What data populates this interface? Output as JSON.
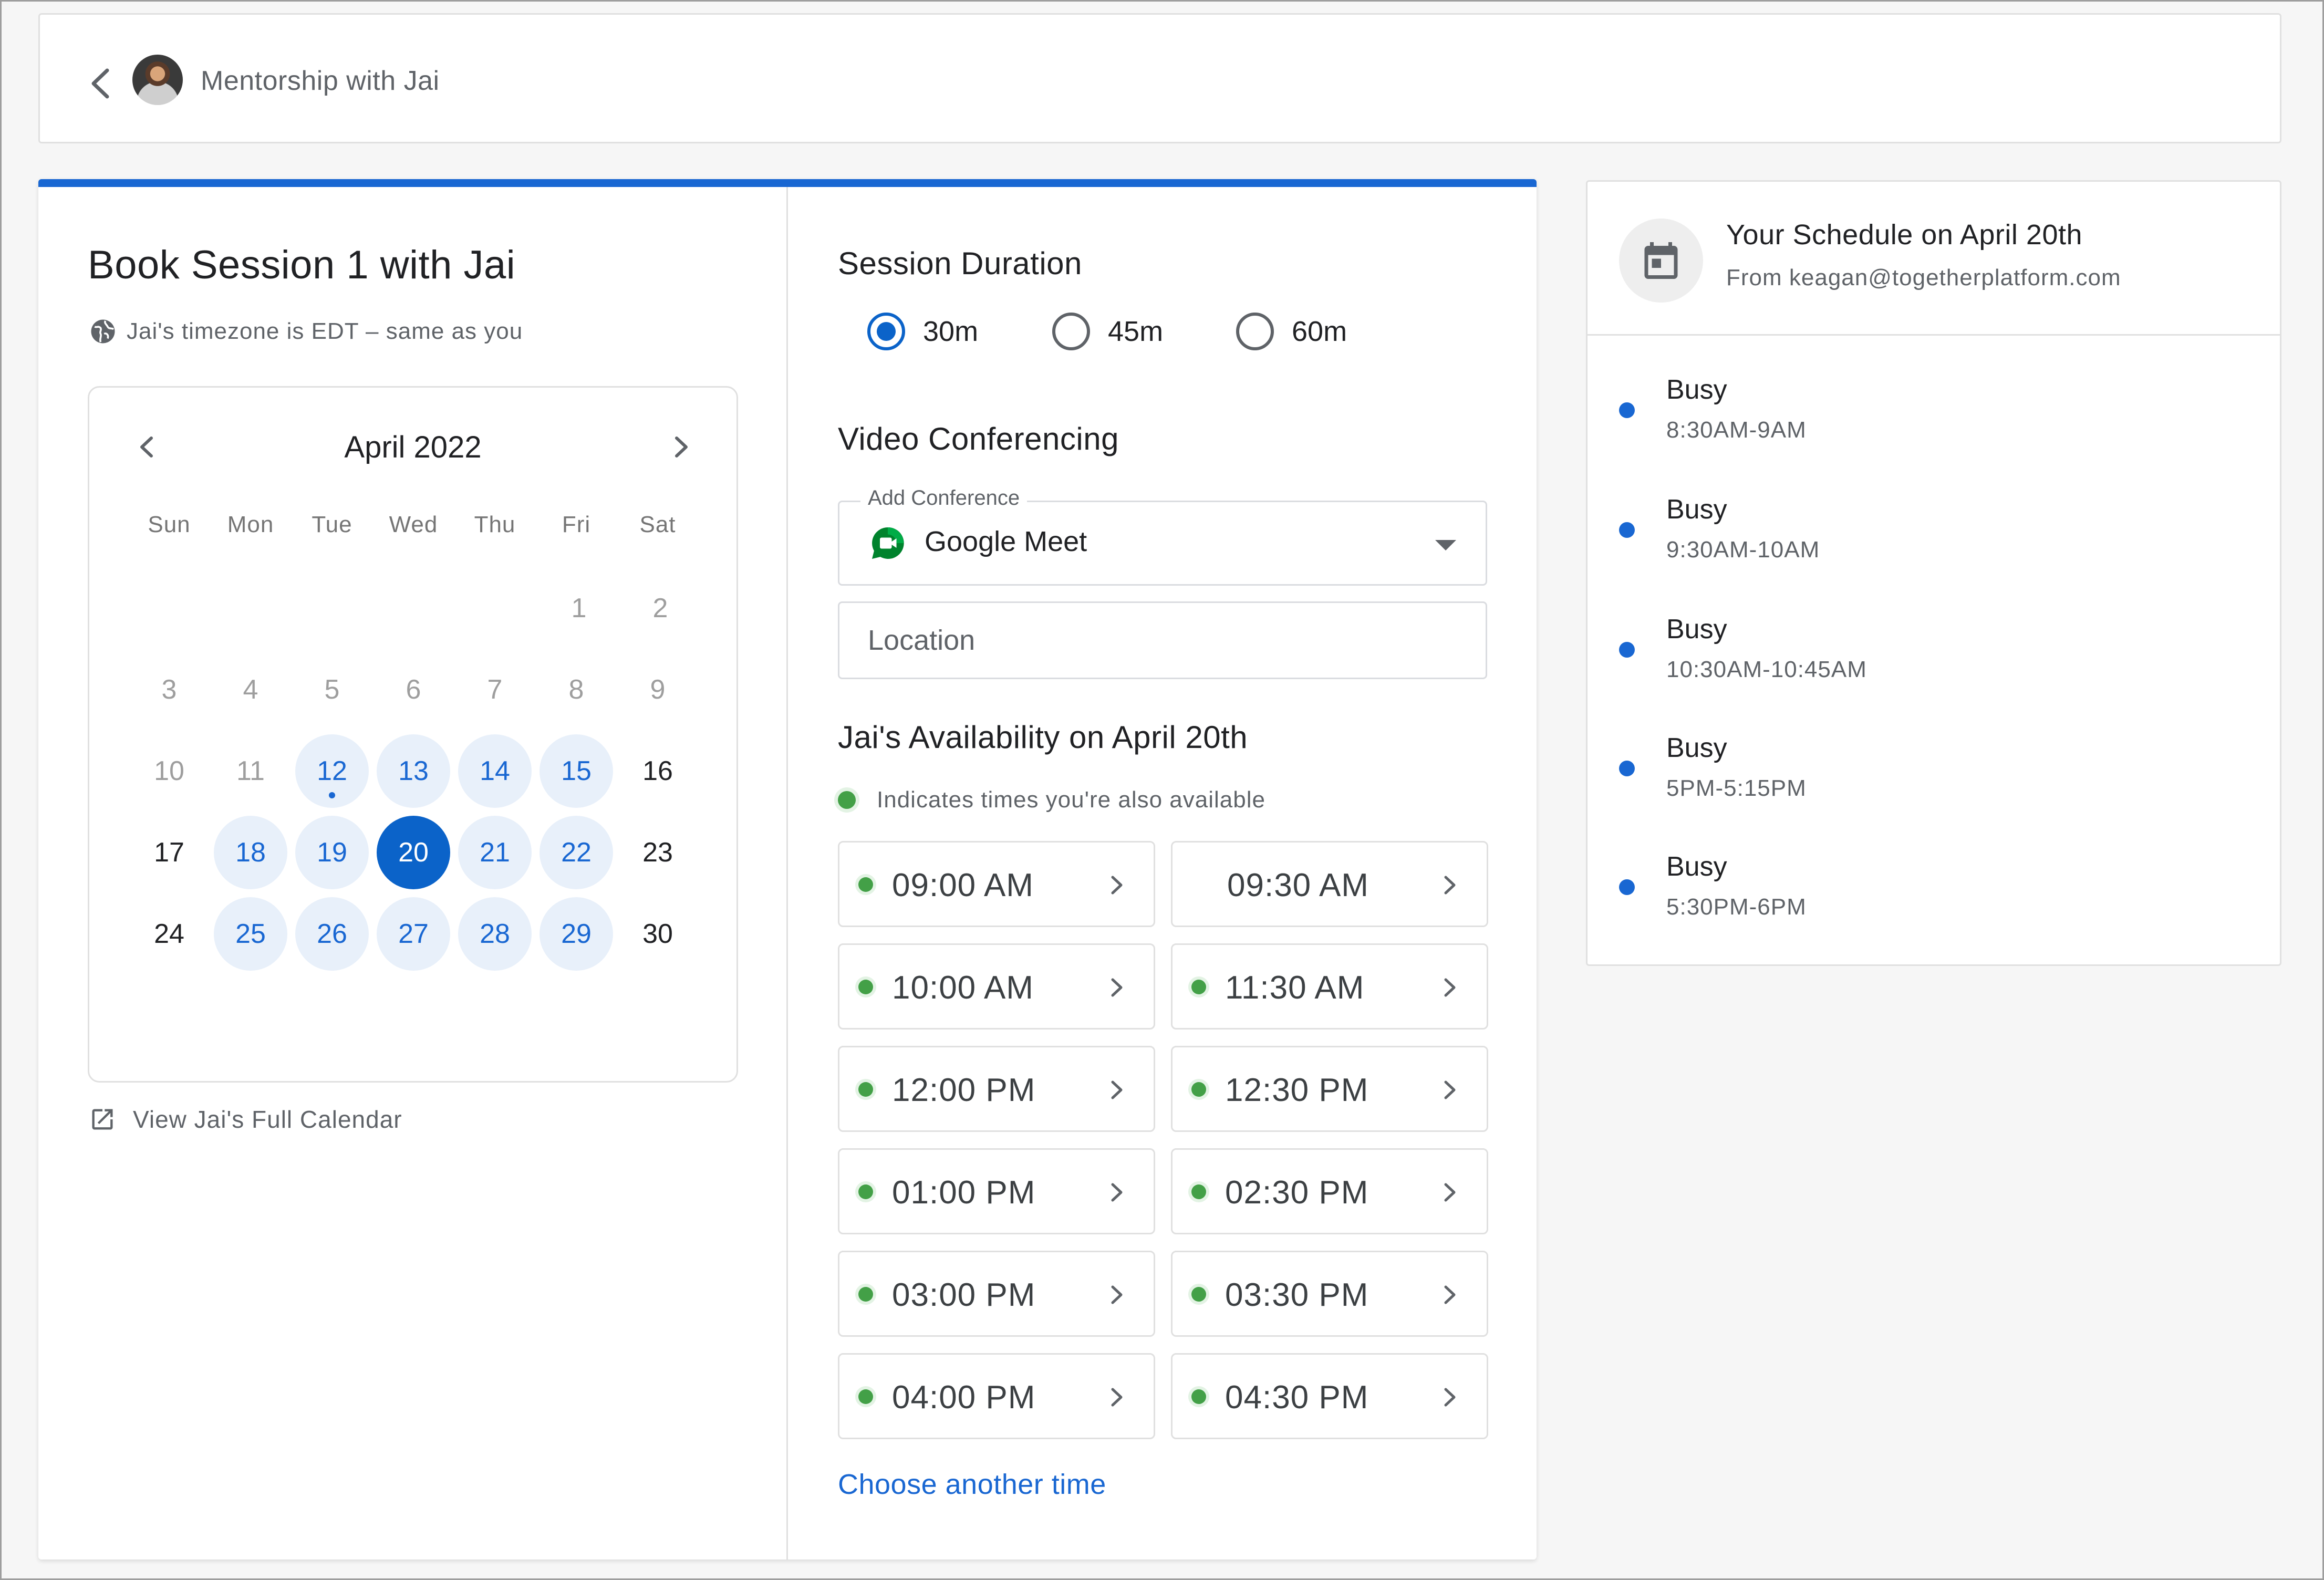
{
  "header": {
    "title": "Mentorship with Jai"
  },
  "booking": {
    "title": "Book Session 1 with Jai",
    "timezone_note": "Jai's timezone is EDT – same as you",
    "calendar": {
      "month_label": "April 2022",
      "weekdays": [
        "Sun",
        "Mon",
        "Tue",
        "Wed",
        "Thu",
        "Fri",
        "Sat"
      ],
      "days": [
        "1",
        "2",
        "3",
        "4",
        "5",
        "6",
        "7",
        "8",
        "9",
        "10",
        "11",
        "12",
        "13",
        "14",
        "15",
        "16",
        "17",
        "18",
        "19",
        "20",
        "21",
        "22",
        "23",
        "24",
        "25",
        "26",
        "27",
        "28",
        "29",
        "30"
      ],
      "selected_day": "20",
      "today": "12"
    },
    "full_calendar_link": "View Jai's Full Calendar"
  },
  "session": {
    "duration_title": "Session Duration",
    "durations": [
      "30m",
      "45m",
      "60m"
    ],
    "selected_duration": "30m",
    "video_title": "Video Conferencing",
    "conference_legend": "Add Conference",
    "conference_value": "Google Meet",
    "location_placeholder": "Location",
    "availability_title": "Jai's Availability on April 20th",
    "availability_legend": "Indicates times you're also available",
    "slots": [
      "09:00 AM",
      "09:30 AM",
      "10:00 AM",
      "11:30 AM",
      "12:00 PM",
      "12:30 PM",
      "01:00 PM",
      "02:30 PM",
      "03:00 PM",
      "03:30 PM",
      "04:00 PM",
      "04:30 PM"
    ],
    "choose_another": "Choose another time"
  },
  "schedule": {
    "title": "Your Schedule on April 20th",
    "subtitle": "From keagan@togetherplatform.com",
    "events": [
      {
        "label": "Busy",
        "time": "8:30AM-9AM"
      },
      {
        "label": "Busy",
        "time": "9:30AM-10AM"
      },
      {
        "label": "Busy",
        "time": "10:30AM-10:45AM"
      },
      {
        "label": "Busy",
        "time": "5PM-5:15PM"
      },
      {
        "label": "Busy",
        "time": "5:30PM-6PM"
      }
    ]
  },
  "colors": {
    "accent": "#1967d2",
    "available": "#43a047",
    "selected_day": "#0b63c9"
  },
  "icons": [
    "back-chevron-icon",
    "globe-icon",
    "external-link-icon",
    "google-meet-icon",
    "calendar-icon",
    "chevron-right-icon"
  ]
}
